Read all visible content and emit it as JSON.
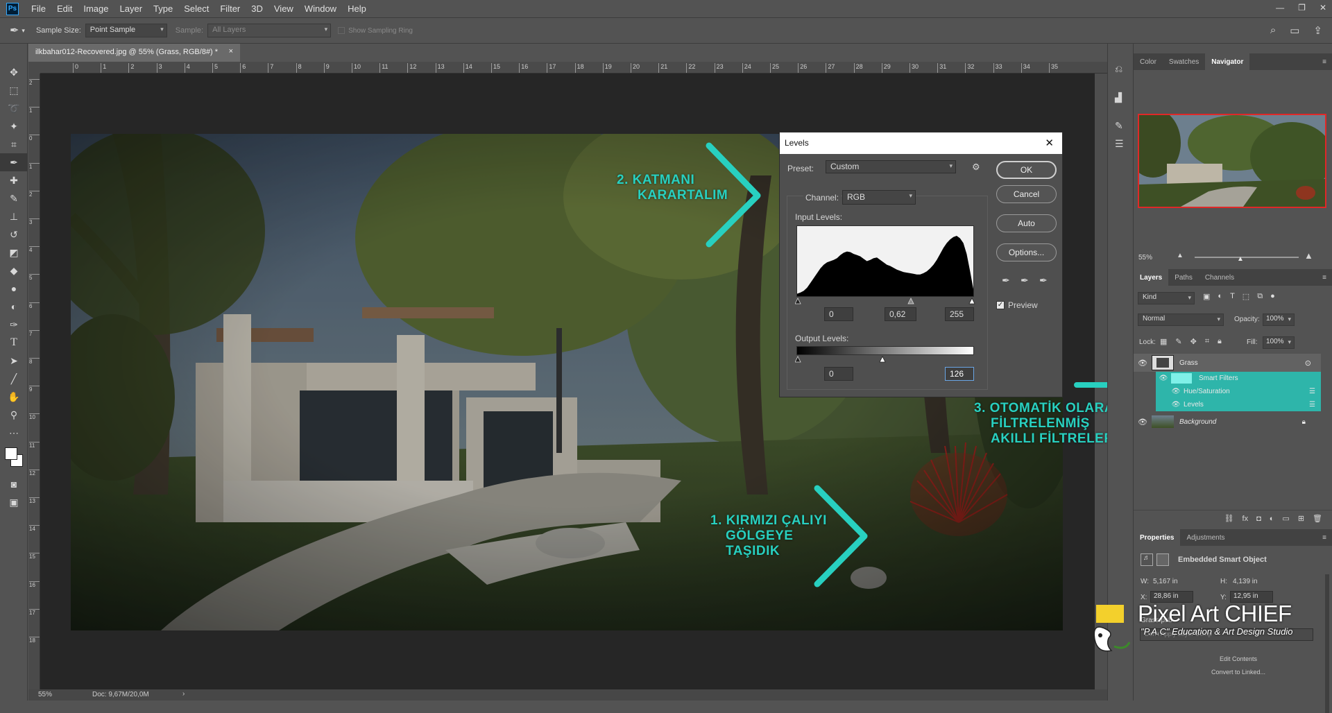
{
  "menu": {
    "logo": "Ps",
    "items": [
      "File",
      "Edit",
      "Image",
      "Layer",
      "Type",
      "Select",
      "Filter",
      "3D",
      "View",
      "Window",
      "Help"
    ]
  },
  "options": {
    "sample_size_label": "Sample Size:",
    "sample_size_value": "Point Sample",
    "sample_label": "Sample:",
    "sample_value": "All Layers",
    "sampling_ring": "Show Sampling Ring"
  },
  "document": {
    "tab_title": "ilkbahar012-Recovered.jpg @ 55% (Grass, RGB/8#) *",
    "close": "×",
    "zoom": "55%",
    "doc_info": "Doc: 9,67M/20,0M"
  },
  "ruler_h": [
    "0",
    "1",
    "2",
    "3",
    "4",
    "5",
    "6",
    "7",
    "8",
    "9",
    "10",
    "11",
    "12",
    "13",
    "14",
    "15",
    "16",
    "17",
    "18",
    "19",
    "20",
    "21",
    "22",
    "23",
    "24",
    "25",
    "26",
    "27",
    "28",
    "29",
    "30",
    "31",
    "32",
    "33",
    "34",
    "35"
  ],
  "ruler_v": [
    "2",
    "1",
    "0",
    "1",
    "2",
    "3",
    "4",
    "5",
    "6",
    "7",
    "8",
    "9",
    "10",
    "11",
    "12",
    "13",
    "14",
    "15",
    "16",
    "17",
    "18"
  ],
  "levels": {
    "title": "Levels",
    "close": "✕",
    "preset_label": "Preset:",
    "preset_value": "Custom",
    "channel_label": "Channel:",
    "channel_value": "RGB",
    "input_label": "Input Levels:",
    "input_black": "0",
    "input_gamma": "0,62",
    "input_white": "255",
    "output_label": "Output Levels:",
    "output_black": "0",
    "output_white": "126",
    "ok": "OK",
    "cancel": "Cancel",
    "auto": "Auto",
    "options": "Options...",
    "preview": "Preview",
    "preview_checked": true
  },
  "annotations": {
    "step1": [
      "1.  KIRMIZI ÇALIYI",
      "GÖLGEYE",
      "TAŞIDIK"
    ],
    "step2": [
      "2.  KATMANI",
      "KARARTALIM"
    ],
    "step3": [
      "3. OTOMATİK OLARAK",
      "FİLTRELENMİŞ",
      "AKILLI FİLTRELER"
    ],
    "color": "#28d0c0"
  },
  "panels": {
    "top_tabs": [
      "Color",
      "Swatches",
      "Navigator"
    ],
    "navigator_zoom": "55%",
    "layers_tabs": [
      "Layers",
      "Paths",
      "Channels"
    ],
    "kind": "Kind",
    "blend_mode": "Normal",
    "opacity_label": "Opacity:",
    "opacity": "100%",
    "lock_label": "Lock:",
    "fill_label": "Fill:",
    "fill": "100%",
    "layers": [
      {
        "name": "Grass",
        "type": "smart-object"
      },
      {
        "name": "Smart Filters",
        "type": "filter-mask"
      },
      {
        "name": "Hue/Saturation",
        "type": "filter"
      },
      {
        "name": "Levels",
        "type": "filter"
      },
      {
        "name": "Background",
        "type": "background"
      }
    ],
    "prop_tabs": [
      "Properties",
      "Adjustments"
    ],
    "prop_title": "Embedded Smart Object",
    "w_label": "W:",
    "w": "5,167 in",
    "h_label": "H:",
    "h": "4,139 in",
    "x_label": "X:",
    "x": "28,86 in",
    "y_label": "Y:",
    "y": "12,95 in",
    "file": "Grass.psb",
    "comp": "Don't Apply Layer Comp",
    "edit_contents": "Edit Contents",
    "convert": "Convert to Linked..."
  },
  "watermark": {
    "brand": "Pixel Art CHIEF",
    "tagline": "\"P.A.C\" Education & Art Design Studio"
  },
  "histogram": [
    4,
    6,
    9,
    14,
    22,
    30,
    38,
    46,
    52,
    56,
    58,
    60,
    63,
    68,
    72,
    74,
    73,
    70,
    68,
    66,
    62,
    58,
    60,
    63,
    64,
    60,
    56,
    52,
    50,
    47,
    44,
    42,
    40,
    39,
    38,
    37,
    36,
    36,
    38,
    41,
    46,
    52,
    60,
    70,
    80,
    88,
    94,
    98,
    100,
    96,
    88,
    70,
    42,
    12
  ]
}
